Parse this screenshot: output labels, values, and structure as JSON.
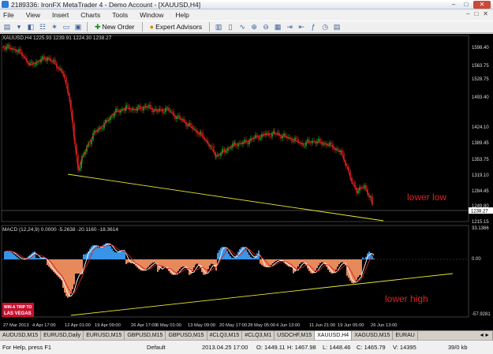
{
  "window": {
    "title": "2189336: IronFX MetaTrader 4 - Demo Account - [XAUUSD,H4]",
    "min": "–",
    "max": "□",
    "close": "✕"
  },
  "menu": {
    "items": [
      "File",
      "View",
      "Insert",
      "Charts",
      "Tools",
      "Window",
      "Help"
    ],
    "right": [
      "–",
      "□",
      "✕"
    ]
  },
  "toolbar": {
    "new_order": "New Order",
    "expert_advisors": "Expert Advisors"
  },
  "chart": {
    "header": "XAUUSD,H4  1225.93 1239.91 1224.30 1238.27",
    "macd_header": "MACD (12,24,9) 0.0000 -5.2638 -20.1160 -18.3614",
    "price_ticks": [
      "1598.40",
      "1563.75",
      "1528.75",
      "1493.40",
      "1424.10",
      "1389.45",
      "1353.75",
      "1319.10",
      "1284.45",
      "1249.80",
      "1215.15"
    ],
    "current_price": "1238.27",
    "macd_ticks": [
      "33.1366",
      "0.00",
      "-57.9281"
    ],
    "time_ticks": [
      "27 Mar 2013",
      "4 Apr 17:00",
      "12 Apr 01:00",
      "19 Apr 09:00",
      "26 Apr 17:00",
      "6 May 01:00",
      "13 May 09:00",
      "20 May 17:00",
      "28 May 05:00",
      "4 Jun 13:00",
      "11 Jun 21:00",
      "19 Jun 05:00",
      "26 Jun 13:00"
    ],
    "annotations": {
      "lower_low": "lower low",
      "lower_high": "lower high"
    },
    "ad": {
      "line1": "WIN A TRIP TO",
      "line2": "LAS VEGAS"
    },
    "colors": {
      "up_candle": "#22c322",
      "down_candle": "#e02020",
      "ma_line": "#e02020",
      "trendline": "#e8e836",
      "histogram_pos": "#3da5ff",
      "histogram_neg": "#ff9966",
      "macd_main": "#ffffff",
      "macd_signal": "#e02020",
      "annotation": "#e02020"
    }
  },
  "tabs": [
    "AUDUSD,M15",
    "EURUSD,Daily",
    "EURUSD,M15",
    "GBPUSD,M15",
    "GBPUSD,M15",
    "#CLQ3,M15",
    "#CLQ3,M1",
    "USDCHF,M15",
    "XAUUSD,H4",
    "XAGUSD,M15",
    "EURAU"
  ],
  "tabs_arrows": "◄►",
  "status": {
    "help": "For Help, press F1",
    "profile": "Default",
    "datetime": "2013.04.25 17:00",
    "open": "O: 1449.11",
    "high": "H: 1467.98",
    "low": "L: 1448.46",
    "close": "C: 1465.79",
    "volume": "V: 14395",
    "traffic": "39/0 kb"
  }
}
